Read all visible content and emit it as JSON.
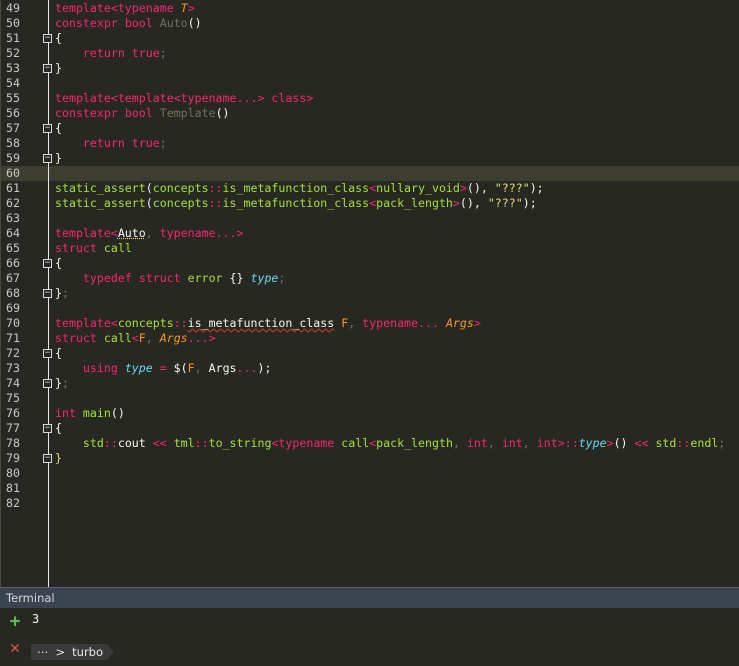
{
  "editor": {
    "current_line": 60,
    "lines": [
      {
        "n": "49",
        "fold": "",
        "segs": [
          [
            "kw",
            "template"
          ],
          [
            "op",
            "<"
          ],
          [
            "kw",
            "typename "
          ],
          [
            "tp",
            "T"
          ],
          [
            "op",
            ">"
          ]
        ]
      },
      {
        "n": "50",
        "fold": "",
        "segs": [
          [
            "kw",
            "constexpr "
          ],
          [
            "kw",
            "bool "
          ],
          [
            "gray",
            "Auto"
          ],
          [
            "plain",
            "()"
          ]
        ]
      },
      {
        "n": "51",
        "fold": "open",
        "segs": [
          [
            "plain",
            "{"
          ]
        ]
      },
      {
        "n": "52",
        "fold": "",
        "segs": [
          [
            "plain",
            "    "
          ],
          [
            "kw",
            "return "
          ],
          [
            "kw",
            "true"
          ],
          [
            "gray",
            ";"
          ]
        ]
      },
      {
        "n": "53",
        "fold": "close",
        "segs": [
          [
            "plain",
            "}"
          ]
        ]
      },
      {
        "n": "54",
        "fold": "",
        "segs": []
      },
      {
        "n": "55",
        "fold": "",
        "segs": [
          [
            "kw",
            "template"
          ],
          [
            "op",
            "<"
          ],
          [
            "kw",
            "template"
          ],
          [
            "op",
            "<"
          ],
          [
            "kw",
            "typename"
          ],
          [
            "op",
            "...> "
          ],
          [
            "kw",
            "class"
          ],
          [
            "op",
            ">"
          ]
        ]
      },
      {
        "n": "56",
        "fold": "",
        "segs": [
          [
            "kw",
            "constexpr "
          ],
          [
            "kw",
            "bool "
          ],
          [
            "gray",
            "Template"
          ],
          [
            "plain",
            "()"
          ]
        ]
      },
      {
        "n": "57",
        "fold": "open",
        "segs": [
          [
            "plain",
            "{"
          ]
        ]
      },
      {
        "n": "58",
        "fold": "",
        "segs": [
          [
            "plain",
            "    "
          ],
          [
            "kw",
            "return "
          ],
          [
            "kw",
            "true"
          ],
          [
            "gray",
            ";"
          ]
        ]
      },
      {
        "n": "59",
        "fold": "close",
        "segs": [
          [
            "plain",
            "}"
          ]
        ]
      },
      {
        "n": "60",
        "fold": "",
        "segs": []
      },
      {
        "n": "61",
        "fold": "",
        "segs": [
          [
            "fn",
            "static_assert"
          ],
          [
            "plain",
            "("
          ],
          [
            "fn",
            "concepts"
          ],
          [
            "op",
            "::"
          ],
          [
            "fn",
            "is_metafunction_class"
          ],
          [
            "op",
            "<"
          ],
          [
            "fn",
            "nullary_void"
          ],
          [
            "op",
            ">"
          ],
          [
            "plain",
            "(), "
          ],
          [
            "str",
            "\"???\""
          ],
          [
            "plain",
            ");"
          ]
        ]
      },
      {
        "n": "62",
        "fold": "",
        "segs": [
          [
            "fn",
            "static_assert"
          ],
          [
            "plain",
            "("
          ],
          [
            "fn",
            "concepts"
          ],
          [
            "op",
            "::"
          ],
          [
            "fn",
            "is_metafunction_class"
          ],
          [
            "op",
            "<"
          ],
          [
            "fn",
            "pack_length"
          ],
          [
            "op",
            ">"
          ],
          [
            "plain",
            "(), "
          ],
          [
            "str",
            "\"???\""
          ],
          [
            "plain",
            ");"
          ]
        ]
      },
      {
        "n": "63",
        "fold": "",
        "segs": []
      },
      {
        "n": "64",
        "fold": "",
        "segs": [
          [
            "kw",
            "template"
          ],
          [
            "op",
            "<"
          ],
          [
            "dotu",
            "Auto"
          ],
          [
            "gray",
            ", "
          ],
          [
            "kw",
            "typename"
          ],
          [
            "op",
            "...>"
          ]
        ]
      },
      {
        "n": "65",
        "fold": "",
        "segs": [
          [
            "kw",
            "struct "
          ],
          [
            "fn",
            "call"
          ]
        ]
      },
      {
        "n": "66",
        "fold": "open",
        "segs": [
          [
            "plain",
            "{"
          ]
        ]
      },
      {
        "n": "67",
        "fold": "",
        "segs": [
          [
            "plain",
            "    "
          ],
          [
            "kw",
            "typedef "
          ],
          [
            "kw",
            "struct "
          ],
          [
            "fn",
            "error "
          ],
          [
            "plain",
            "{} "
          ],
          [
            "ty",
            "type"
          ],
          [
            "gray",
            ";"
          ]
        ]
      },
      {
        "n": "68",
        "fold": "close",
        "segs": [
          [
            "plain",
            "}"
          ],
          [
            "gray",
            ";"
          ]
        ]
      },
      {
        "n": "69",
        "fold": "",
        "segs": []
      },
      {
        "n": "70",
        "fold": "",
        "segs": [
          [
            "kw",
            "template"
          ],
          [
            "op",
            "<"
          ],
          [
            "fn",
            "concepts"
          ],
          [
            "op",
            "::"
          ],
          [
            "sq",
            "is_metafunction_class"
          ],
          [
            "plain",
            " "
          ],
          [
            "orange",
            "F"
          ],
          [
            "gray",
            ", "
          ],
          [
            "kw",
            "typename"
          ],
          [
            "op",
            "... "
          ],
          [
            "tp",
            "Args"
          ],
          [
            "op",
            ">"
          ]
        ]
      },
      {
        "n": "71",
        "fold": "",
        "segs": [
          [
            "kw",
            "struct "
          ],
          [
            "fn",
            "call"
          ],
          [
            "op",
            "<"
          ],
          [
            "orange",
            "F"
          ],
          [
            "gray",
            ", "
          ],
          [
            "tp",
            "Args"
          ],
          [
            "op",
            "...>"
          ]
        ]
      },
      {
        "n": "72",
        "fold": "open",
        "segs": [
          [
            "plain",
            "{"
          ]
        ]
      },
      {
        "n": "73",
        "fold": "",
        "segs": [
          [
            "plain",
            "    "
          ],
          [
            "kw",
            "using "
          ],
          [
            "ty",
            "type"
          ],
          [
            "plain",
            " "
          ],
          [
            "op",
            "="
          ],
          [
            "plain",
            " $("
          ],
          [
            "orange",
            "F"
          ],
          [
            "gray",
            ", "
          ],
          [
            "plain",
            "Args"
          ],
          [
            "op",
            "..."
          ],
          [
            "plain",
            ");"
          ]
        ]
      },
      {
        "n": "74",
        "fold": "close",
        "segs": [
          [
            "plain",
            "}"
          ],
          [
            "gray",
            ";"
          ]
        ]
      },
      {
        "n": "75",
        "fold": "",
        "segs": []
      },
      {
        "n": "76",
        "fold": "",
        "segs": [
          [
            "kw",
            "int "
          ],
          [
            "fn",
            "main"
          ],
          [
            "plain",
            "()"
          ]
        ]
      },
      {
        "n": "77",
        "fold": "open",
        "segs": [
          [
            "plain",
            "{"
          ]
        ]
      },
      {
        "n": "78",
        "fold": "",
        "segs": [
          [
            "plain",
            "    "
          ],
          [
            "fn",
            "std"
          ],
          [
            "op",
            "::"
          ],
          [
            "plain",
            "cout"
          ],
          [
            "op",
            " << "
          ],
          [
            "fn",
            "tml"
          ],
          [
            "op",
            "::"
          ],
          [
            "fn",
            "to_string"
          ],
          [
            "op",
            "<"
          ],
          [
            "kw",
            "typename "
          ],
          [
            "fn",
            "call"
          ],
          [
            "op",
            "<"
          ],
          [
            "fn",
            "pack_length"
          ],
          [
            "gray",
            ", "
          ],
          [
            "kw",
            "int"
          ],
          [
            "gray",
            ", "
          ],
          [
            "kw",
            "int"
          ],
          [
            "gray",
            ", "
          ],
          [
            "kw",
            "int"
          ],
          [
            "op",
            ">::"
          ],
          [
            "ty",
            "type"
          ],
          [
            "op",
            ">"
          ],
          [
            "plain",
            "()"
          ],
          [
            "op",
            " << "
          ],
          [
            "fn",
            "std"
          ],
          [
            "op",
            "::"
          ],
          [
            "fn",
            "endl"
          ],
          [
            "gray",
            ";"
          ]
        ]
      },
      {
        "n": "79",
        "fold": "close",
        "segs": [
          [
            "str",
            "}"
          ]
        ]
      },
      {
        "n": "80",
        "fold": "",
        "segs": []
      },
      {
        "n": "81",
        "fold": "",
        "segs": []
      },
      {
        "n": "82",
        "fold": "",
        "segs": []
      }
    ]
  },
  "terminal": {
    "title": "Terminal",
    "output": "3",
    "add_icon": "plus-icon",
    "close_icon": "close-icon",
    "prompt_path": "⋯",
    "prompt_sep": ">",
    "prompt_dir": "turbo",
    "colors": {
      "add": "#5fb858",
      "close": "#e25050"
    }
  }
}
